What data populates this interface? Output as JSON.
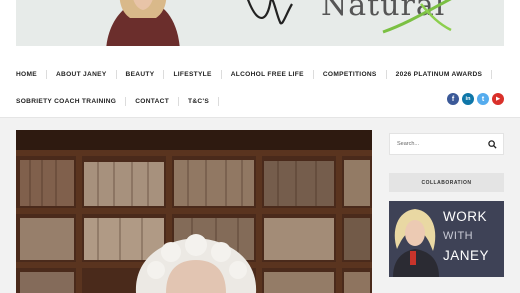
{
  "banner": {
    "title": "Natural"
  },
  "nav": {
    "row1": [
      "HOME",
      "ABOUT JANEY",
      "BEAUTY",
      "LIFESTYLE",
      "ALCOHOL FREE LIFE",
      "COMPETITIONS",
      "2026 PLATINUM AWARDS"
    ],
    "row2": [
      "SOBRIETY COACH TRAINING",
      "CONTACT",
      "T&C'S"
    ]
  },
  "social": [
    {
      "icon": "facebook-icon",
      "glyph": "f",
      "color": "#3b5998"
    },
    {
      "icon": "linkedin-icon",
      "glyph": "in",
      "color": "#0e76a8"
    },
    {
      "icon": "twitter-icon",
      "glyph": "t",
      "color": "#55acee"
    },
    {
      "icon": "youtube-icon",
      "glyph": "▶",
      "color": "#d9302a"
    }
  ],
  "sidebar": {
    "search_placeholder": "Search...",
    "collab_heading": "COLLABORATION",
    "ad": {
      "line1": "WORK",
      "line2": "WITH",
      "line3": "JANEY"
    }
  }
}
